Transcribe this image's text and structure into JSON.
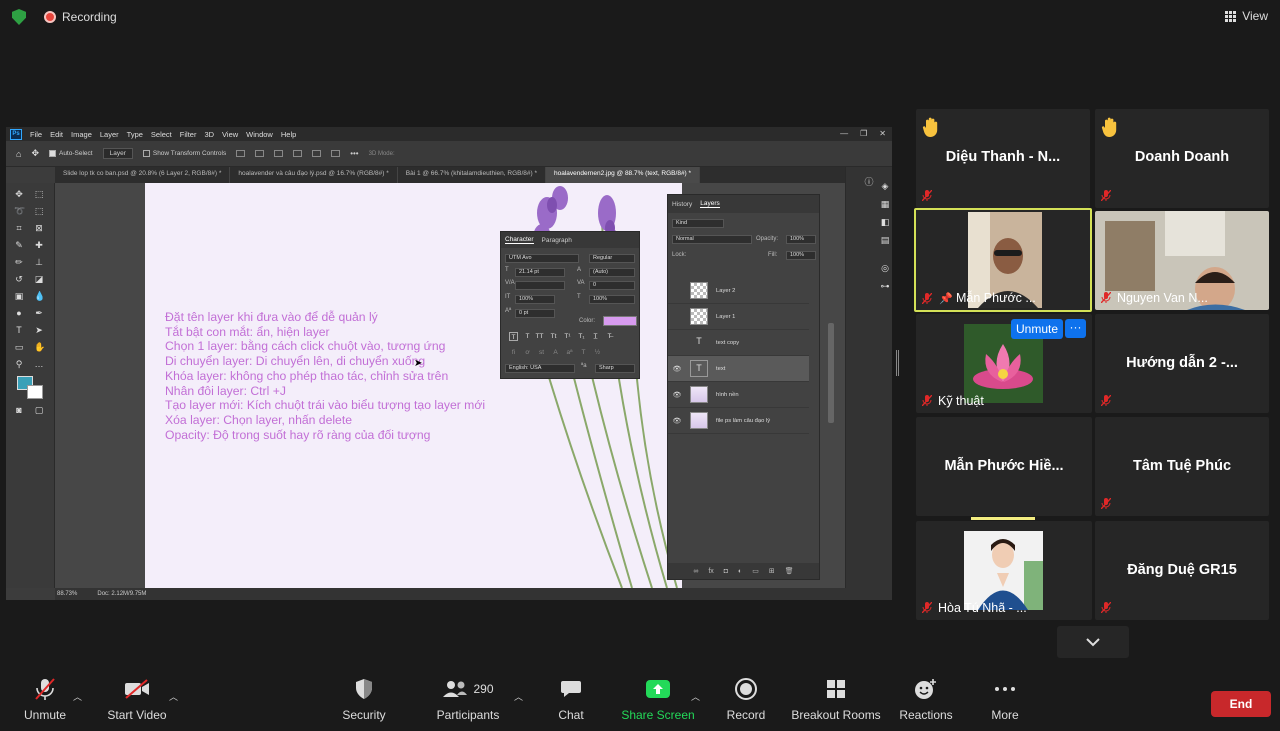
{
  "topbar": {
    "recording_label": "Recording",
    "view_label": "View"
  },
  "photoshop": {
    "menu": [
      "File",
      "Edit",
      "Image",
      "Layer",
      "Type",
      "Select",
      "Filter",
      "3D",
      "View",
      "Window",
      "Help"
    ],
    "options": {
      "auto_select": "Auto-Select",
      "layer_select": "Layer",
      "transform_controls": "Show Transform Controls",
      "mode_3d": "3D Mode:"
    },
    "tabs": [
      "Slide lop tk co ban.psd @ 20.8% (6 Layer 2, RGB/8#) *",
      "hoalavender và câu đạo lý.psd @ 16.7% (RGB/8#) *",
      "Bài 1 @ 66.7% (khitalamdieuthien, RGB/8#) *",
      "hoalavendernen2.jpg @ 88.7% (text, RGB/8#) *"
    ],
    "active_tab_index": 3,
    "canvas_lines": [
      "Đặt tên layer khi đưa vào để dễ quản lý",
      "Tắt bật con mắt: ẩn, hiện layer",
      "Chọn 1 layer: bằng cách click chuột vào, tương ứng",
      "Di chuyển layer: Di chuyển lên, di chuyển xuống",
      "Khóa layer: không cho phép thao tác, chỉnh sửa trên",
      "Nhân đôi layer: Ctrl +J",
      "Tạo layer mới: Kích chuột trái vào biểu tượng tạo layer mới",
      "Xóa layer: Chọn layer, nhấn delete",
      "Opacity: Độ trong suốt hay rõ ràng của đối tượng"
    ],
    "canvas_text_color": "#c26fd6",
    "status": {
      "zoom": "88.73%",
      "doc": "Doc: 2.12M/9.75M"
    },
    "character_panel": {
      "tabs": [
        "Character",
        "Paragraph"
      ],
      "font": "UTM Avo",
      "style": "Regular",
      "size": "21.14 pt",
      "leading": "(Auto)",
      "kerning": "",
      "tracking": "0",
      "vscale": "100%",
      "hscale": "100%",
      "baseline": "0 pt",
      "color_label": "Color:",
      "color": "#d79bef",
      "language": "English: USA",
      "antialias": "Sharp"
    },
    "layers_panel": {
      "tabs": [
        "History",
        "Layers"
      ],
      "filter": "Kind",
      "blend": "Normal",
      "opacity_label": "Opacity:",
      "opacity": "100%",
      "lock_label": "Lock:",
      "fill_label": "Fill:",
      "fill": "100%",
      "layers": [
        {
          "name": "Layer 2",
          "kind": "pixel",
          "visible": false
        },
        {
          "name": "Layer 1",
          "kind": "pixel",
          "visible": false
        },
        {
          "name": "text copy",
          "kind": "text",
          "visible": false
        },
        {
          "name": "text",
          "kind": "text",
          "visible": true,
          "selected": true
        },
        {
          "name": "hình nền",
          "kind": "image",
          "visible": true
        },
        {
          "name": "file ps làm câu đạo lý",
          "kind": "image",
          "visible": true
        }
      ]
    }
  },
  "participants": [
    {
      "name": "Diệu Thanh - N...",
      "hand": true,
      "muted": true,
      "style": "name"
    },
    {
      "name": "Doanh Doanh",
      "hand": true,
      "muted": true,
      "style": "name"
    },
    {
      "name": "Mẫn Phước ...",
      "muted": true,
      "pinned": true,
      "style": "video",
      "active": true
    },
    {
      "name": "Nguyen Van N...",
      "muted": true,
      "style": "video"
    },
    {
      "name": "Kỹ thuật",
      "muted": true,
      "style": "video"
    },
    {
      "name": "Hướng dẫn 2 -...",
      "muted": true,
      "style": "name"
    },
    {
      "name": "Mẫn Phước Hiề...",
      "muted": false,
      "style": "name"
    },
    {
      "name": "Tâm Tuệ Phúc",
      "muted": true,
      "style": "name"
    },
    {
      "name": "Hòa Tú Nhã - ...",
      "muted": true,
      "style": "video"
    },
    {
      "name": "Đăng Duệ GR15",
      "muted": true,
      "style": "name"
    }
  ],
  "tile_unmute_label": "Unmute",
  "tile_more_label": "···",
  "toolbar": {
    "unmute": "Unmute",
    "start_video": "Start Video",
    "security": "Security",
    "participants": "Participants",
    "participants_count": "290",
    "chat": "Chat",
    "share_screen": "Share Screen",
    "record": "Record",
    "breakout": "Breakout Rooms",
    "reactions": "Reactions",
    "more": "More",
    "end": "End"
  },
  "colors": {
    "share_green": "#23d959",
    "end_red": "#c8282b",
    "unmute_blue": "#0e72ed",
    "active_border": "#d4e157",
    "hand_yellow": "#f7c23e",
    "mute_red": "#e02828"
  }
}
